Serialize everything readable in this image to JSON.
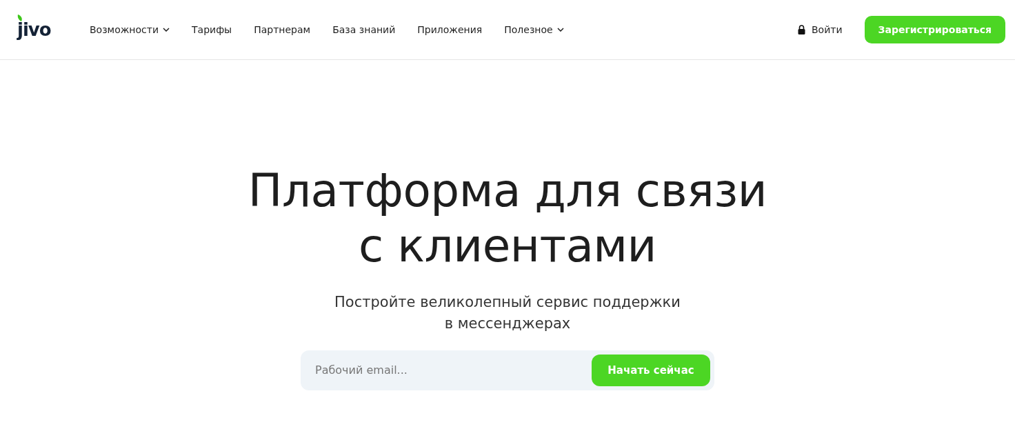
{
  "header": {
    "logo": "jivo",
    "nav": [
      {
        "label": "Возможности",
        "kind": "dropdown"
      },
      {
        "label": "Тарифы",
        "kind": "link"
      },
      {
        "label": "Партнерам",
        "kind": "link"
      },
      {
        "label": "База знаний",
        "kind": "link"
      },
      {
        "label": "Приложения",
        "kind": "link"
      },
      {
        "label": "Полезное",
        "kind": "dropdown"
      }
    ],
    "login": "Войти",
    "signup": "Зарегистрироваться"
  },
  "hero": {
    "title_lines": [
      "Платформа для связи",
      "с клиентами"
    ],
    "subtitle_lines": [
      "Постройте великолепный сервис поддержки",
      "в мессенджерах"
    ],
    "email": {
      "placeholder": "Рабочий email..."
    },
    "cta": "Начать сейчас"
  }
}
